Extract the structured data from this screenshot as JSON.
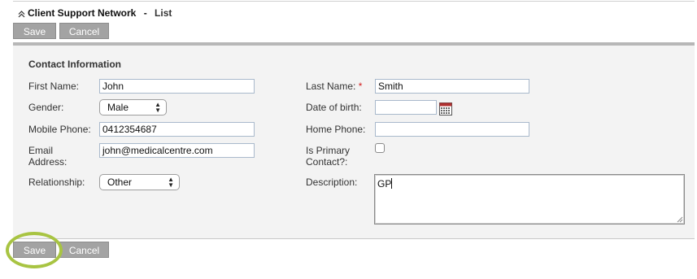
{
  "header": {
    "title": "Client Support Network",
    "separator": "-",
    "subtitle": "List",
    "collapse_icon": "double-chevron-up-icon"
  },
  "toolbar_top": {
    "save_label": "Save",
    "cancel_label": "Cancel"
  },
  "form": {
    "section_title": "Contact Information",
    "first_name": {
      "label": "First Name:",
      "value": "John"
    },
    "last_name": {
      "label": "Last Name:",
      "required_mark": "*",
      "value": "Smith"
    },
    "gender": {
      "label": "Gender:",
      "value": "Male"
    },
    "date_of_birth": {
      "label": "Date of birth:",
      "value": "",
      "icon": "calendar-icon"
    },
    "mobile_phone": {
      "label": "Mobile Phone:",
      "value": "0412354687"
    },
    "home_phone": {
      "label": "Home Phone:",
      "value": ""
    },
    "email": {
      "label_line1": "Email",
      "label_line2": "Address:",
      "value": "john@medicalcentre.com"
    },
    "is_primary": {
      "label_line1": "Is Primary",
      "label_line2": "Contact?:",
      "checked": false
    },
    "relationship": {
      "label": "Relationship:",
      "value": "Other"
    },
    "description": {
      "label": "Description:",
      "value": "GP"
    }
  },
  "toolbar_bottom": {
    "save_label": "Save",
    "cancel_label": "Cancel"
  },
  "colors": {
    "highlight_ring": "#a8c442",
    "button_bg": "#a3a3a3",
    "panel_bg": "#f3f3f3"
  }
}
